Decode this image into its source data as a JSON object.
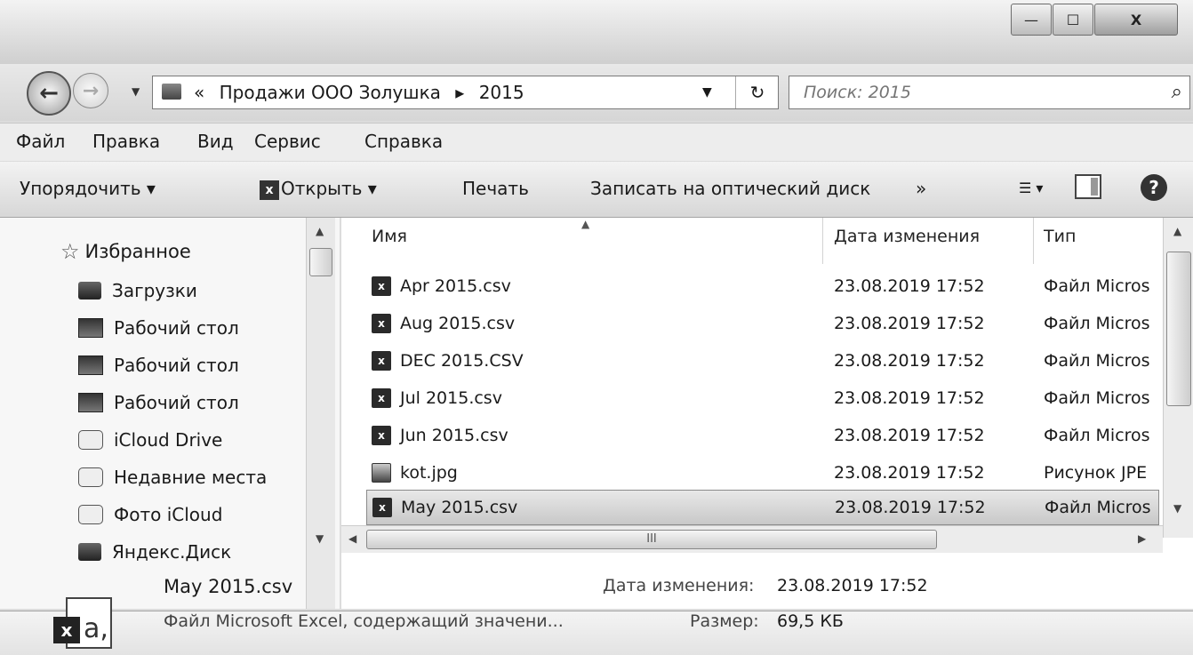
{
  "window": {
    "minimize_glyph": "—",
    "maximize_glyph": "☐",
    "close_glyph": "X"
  },
  "address": {
    "overflow": "«",
    "crumb1": "Продажи ООО Золушка",
    "separator": "▸",
    "crumb2": "2015",
    "search_placeholder": "Поиск: 2015"
  },
  "menu": [
    "Файл",
    "Правка",
    "Вид",
    "Сервис",
    "Справка"
  ],
  "toolbar": {
    "organize": "Упорядочить ▾",
    "open": "Открыть ▾",
    "print": "Печать",
    "burn": "Записать на оптический диск",
    "more": "»"
  },
  "nav": {
    "favorites": "Избранное",
    "items": [
      "Загрузки",
      "Рабочий стол",
      "Рабочий стол",
      "Рабочий стол",
      "iCloud Drive",
      "Недавние места",
      "Фото iCloud",
      "Яндекс.Диск"
    ]
  },
  "columns": {
    "name": "Имя",
    "date": "Дата изменения",
    "type": "Тип"
  },
  "files": [
    {
      "name": "Apr 2015.csv",
      "date": "23.08.2019 17:52",
      "type": "Файл Micros"
    },
    {
      "name": "Aug 2015.csv",
      "date": "23.08.2019 17:52",
      "type": "Файл Micros"
    },
    {
      "name": "DEC 2015.CSV",
      "date": "23.08.2019 17:52",
      "type": "Файл Micros"
    },
    {
      "name": "Jul 2015.csv",
      "date": "23.08.2019 17:52",
      "type": "Файл Micros"
    },
    {
      "name": "Jun 2015.csv",
      "date": "23.08.2019 17:52",
      "type": "Файл Micros"
    },
    {
      "name": "kot.jpg",
      "date": "23.08.2019 17:52",
      "type": "Рисунок JPE"
    },
    {
      "name": "May 2015.csv",
      "date": "23.08.2019 17:52",
      "type": "Файл Micros"
    }
  ],
  "details": {
    "name": "May 2015.csv",
    "description": "Файл Microsoft Excel, содержащий значени...",
    "modified_label": "Дата изменения:",
    "modified_value": "23.08.2019 17:52",
    "size_label": "Размер:",
    "size_value": "69,5 КБ"
  },
  "icons": {
    "excel": "excel-file-icon",
    "image": "image-file-icon",
    "folder": "folder-icon",
    "search": "search-icon",
    "refresh": "refresh-icon",
    "help": "help-icon"
  }
}
